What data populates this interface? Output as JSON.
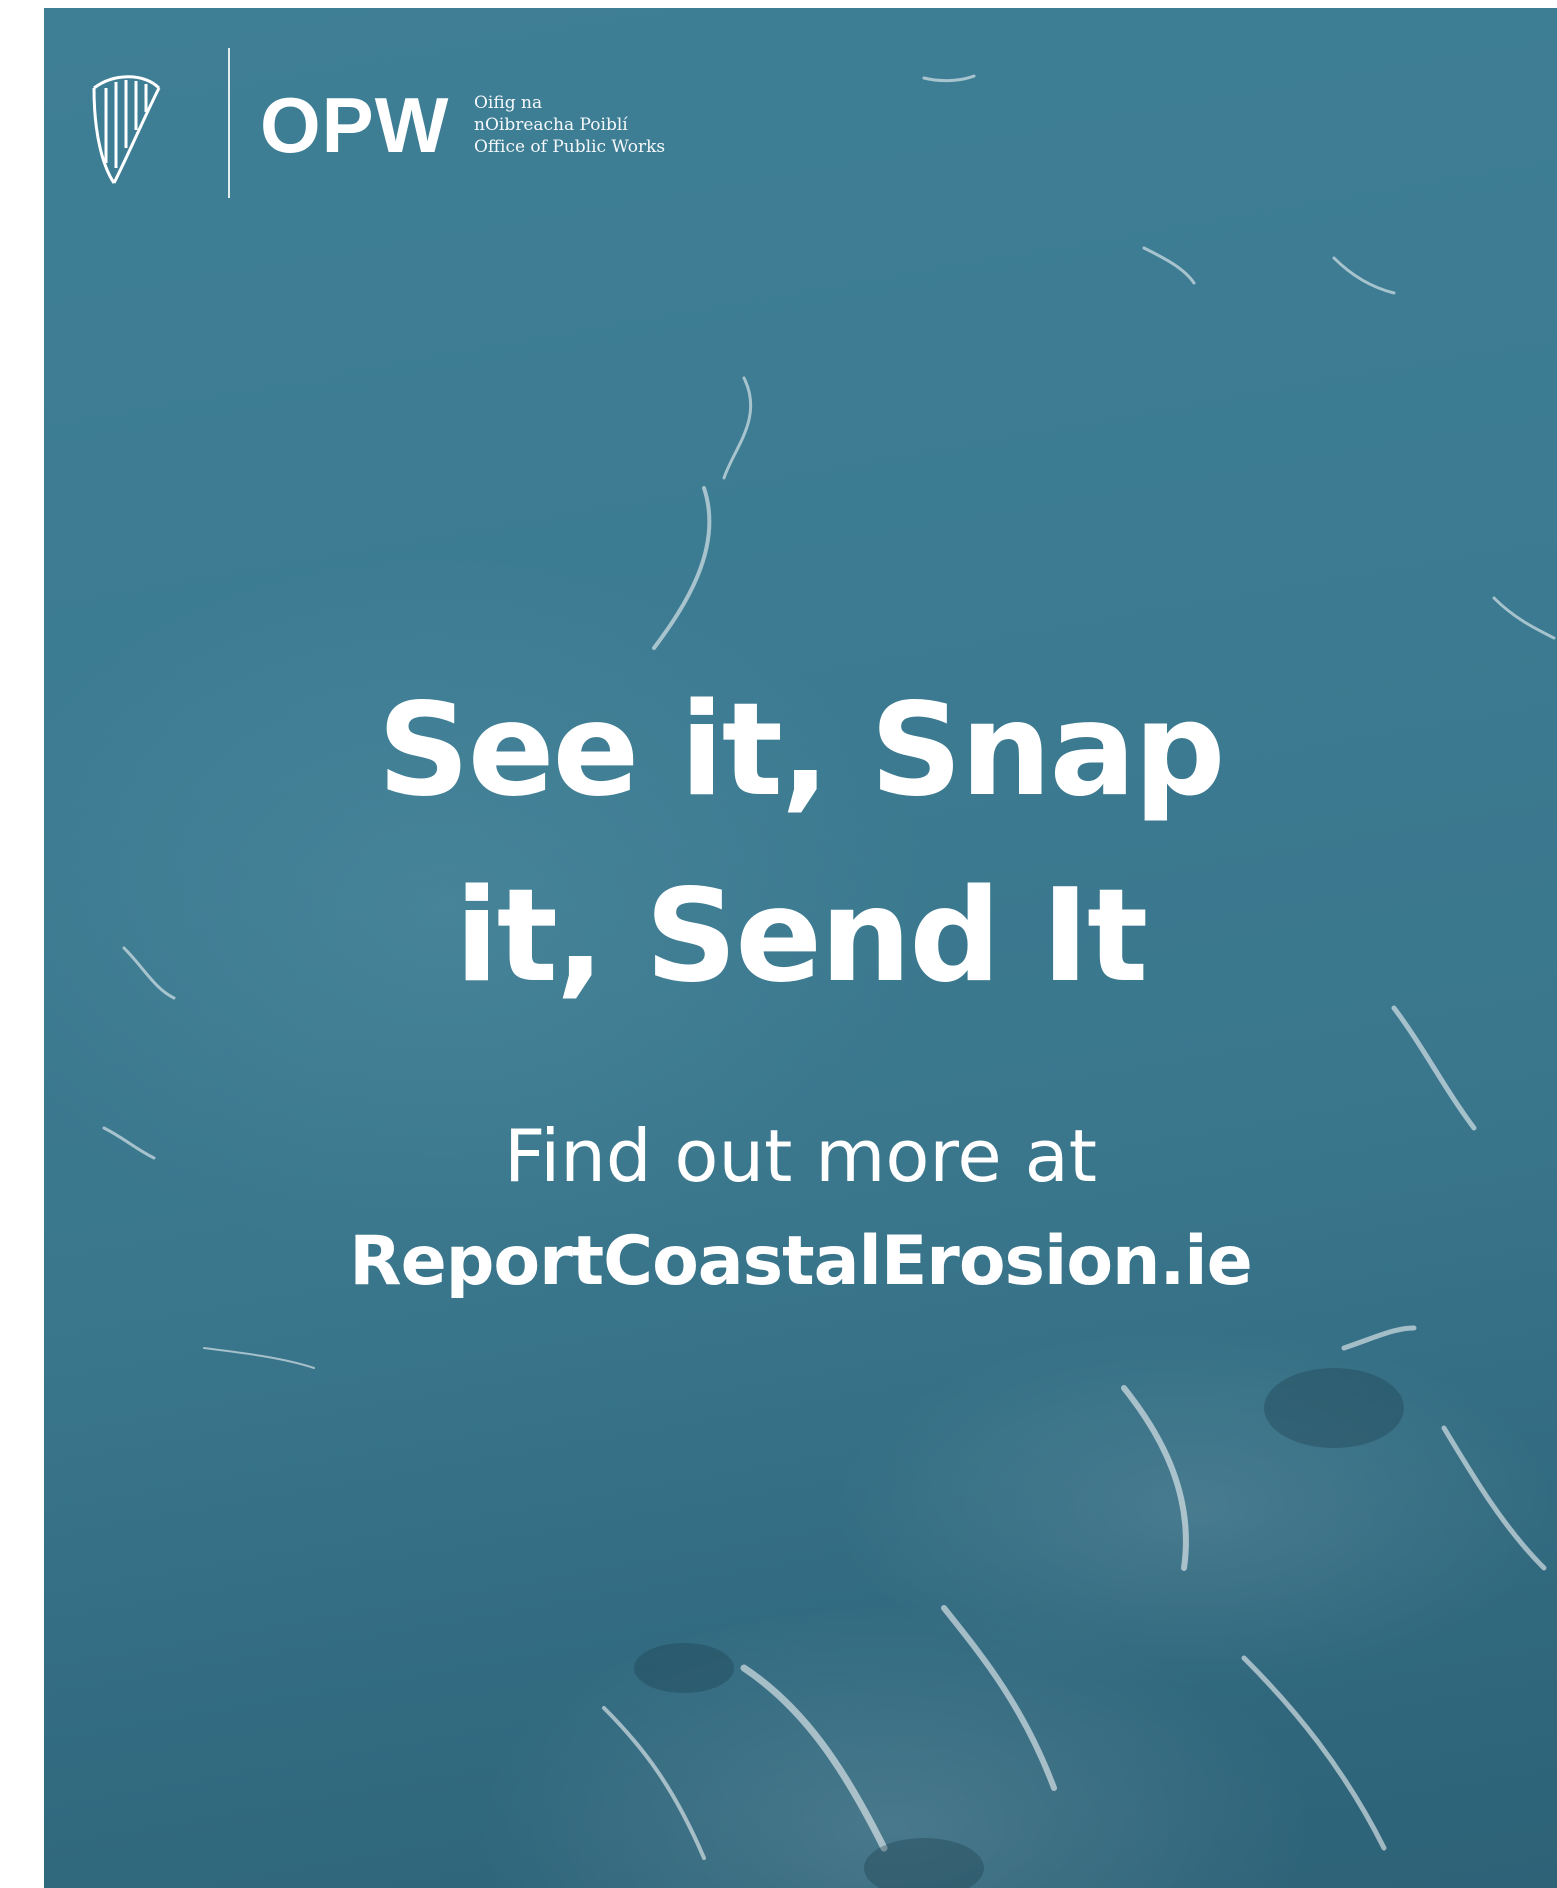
{
  "logo": {
    "emblem_icon": "harp-icon",
    "wordmark": "OPW",
    "lines": [
      "Oifig na",
      "nOibreacha Poiblí",
      "Office of Public Works"
    ]
  },
  "headline": {
    "line1": "See it, Snap",
    "line2": "it, Send It"
  },
  "cta": {
    "lead": "Find out more at",
    "url": "ReportCoastalErosion.ie"
  },
  "colors": {
    "sea": "#3c7b92",
    "text": "#ffffff"
  }
}
